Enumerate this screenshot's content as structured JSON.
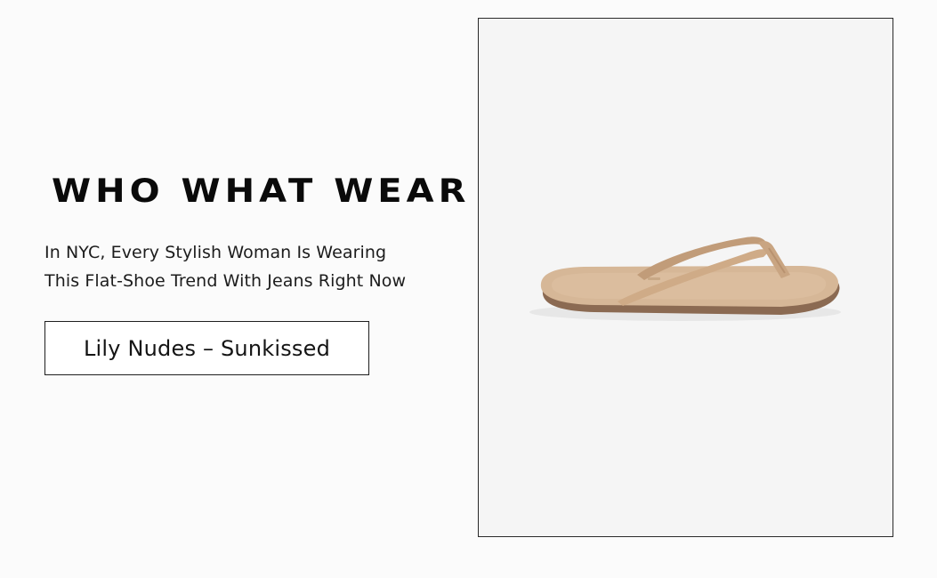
{
  "brand": {
    "logo_text": "WHO WHAT WEAR"
  },
  "article": {
    "headline_line1": "In NYC, Every Stylish Woman Is Wearing",
    "headline_line2": "This Flat-Shoe Trend With Jeans Right Now"
  },
  "product": {
    "button_label": "Lily Nudes – Sunkissed",
    "image_icon": "flip-flop-sandal-icon",
    "sandal_color": "#d6b797",
    "sole_color": "#8b6a52",
    "strap_color": "#c9a582"
  },
  "colors": {
    "background": "#fbfbfb",
    "frame_background": "#f5f5f5",
    "text": "#1a1a1a"
  }
}
